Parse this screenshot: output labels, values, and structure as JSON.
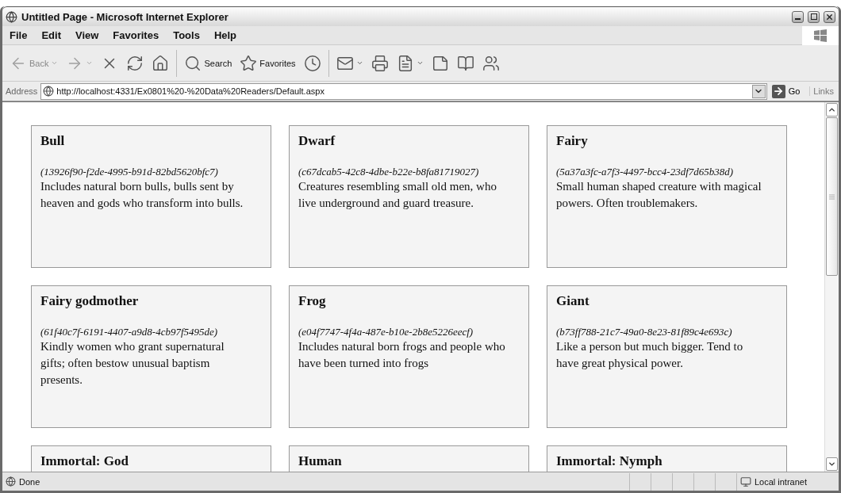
{
  "window": {
    "title": "Untitled Page - Microsoft Internet Explorer"
  },
  "menu": [
    "File",
    "Edit",
    "View",
    "Favorites",
    "Tools",
    "Help"
  ],
  "toolbar": [
    {
      "kind": "back",
      "label": "Back",
      "disabled": true
    },
    {
      "kind": "forward",
      "disabled": true
    },
    {
      "kind": "stop",
      "disabled": false
    },
    {
      "kind": "refresh",
      "disabled": false
    },
    {
      "kind": "home",
      "disabled": false
    },
    {
      "kind": "search",
      "label": "Search",
      "disabled": false
    },
    {
      "kind": "favorites",
      "label": "Favorites",
      "disabled": false
    },
    {
      "kind": "history",
      "disabled": false
    },
    {
      "kind": "mail",
      "disabled": false
    },
    {
      "kind": "print",
      "disabled": false
    },
    {
      "kind": "edit",
      "disabled": false
    },
    {
      "kind": "note",
      "disabled": false
    },
    {
      "kind": "research",
      "disabled": false
    },
    {
      "kind": "messenger",
      "disabled": false
    }
  ],
  "address": {
    "label": "Address",
    "url": "http://localhost:4331/Ex0801%20-%20Data%20Readers/Default.aspx",
    "go": "Go",
    "links": "Links"
  },
  "cards": [
    {
      "title": "Bull",
      "id": "(13926f90-f2de-4995-b91d-82bd5620bfc7)",
      "description": "Includes natural born bulls, bulls sent by heaven and gods who transform into bulls."
    },
    {
      "title": "Dwarf",
      "id": "(c67dcab5-42c8-4dbe-b22e-b8fa81719027)",
      "description": "Creatures resembling small old men, who live underground and guard treasure."
    },
    {
      "title": "Fairy",
      "id": "(5a37a3fc-a7f3-4497-bcc4-23df7d65b38d)",
      "description": "Small human shaped creature with magical powers. Often troublemakers."
    },
    {
      "title": "Fairy godmother",
      "id": "(61f40c7f-6191-4407-a9d8-4cb97f5495de)",
      "description": "Kindly women who grant supernatural gifts; often bestow unusual baptism presents."
    },
    {
      "title": "Frog",
      "id": "(e04f7747-4f4a-487e-b10e-2b8e5226eecf)",
      "description": "Includes natural born frogs and people who have been turned into frogs"
    },
    {
      "title": "Giant",
      "id": "(b73ff788-21c7-49a0-8e23-81f89c4e693c)",
      "description": "Like a person but much bigger. Tend to have great physical power."
    },
    {
      "title": "Immortal: God"
    },
    {
      "title": "Human"
    },
    {
      "title": "Immortal: Nymph"
    }
  ],
  "status": {
    "text": "Done",
    "zone": "Local intranet"
  }
}
